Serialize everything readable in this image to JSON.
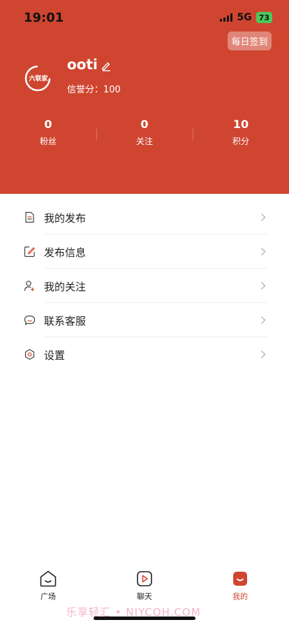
{
  "status_bar": {
    "time": "19:01",
    "network": "5G",
    "battery": "73"
  },
  "header": {
    "checkin_label": "每日签到",
    "avatar_text": "六联家",
    "username": "ooti",
    "credit_label": "信誉分：100"
  },
  "stats": [
    {
      "value": "0",
      "label": "粉丝"
    },
    {
      "value": "0",
      "label": "关注"
    },
    {
      "value": "10",
      "label": "积分"
    }
  ],
  "menu": [
    {
      "label": "我的发布",
      "icon": "document-icon"
    },
    {
      "label": "发布信息",
      "icon": "edit-square-icon"
    },
    {
      "label": "我的关注",
      "icon": "user-add-icon"
    },
    {
      "label": "联系客服",
      "icon": "chat-bubble-icon"
    },
    {
      "label": "设置",
      "icon": "gear-icon"
    }
  ],
  "tabbar": [
    {
      "label": "广场",
      "icon": "home-face-icon",
      "active": false
    },
    {
      "label": "聊天",
      "icon": "play-chat-icon",
      "active": false
    },
    {
      "label": "我的",
      "icon": "profile-face-icon",
      "active": true
    }
  ],
  "watermark": "乐享轻汇 • NIYCOH.COM",
  "colors": {
    "brand": "#cf4530",
    "active_tab": "#cf4530"
  }
}
